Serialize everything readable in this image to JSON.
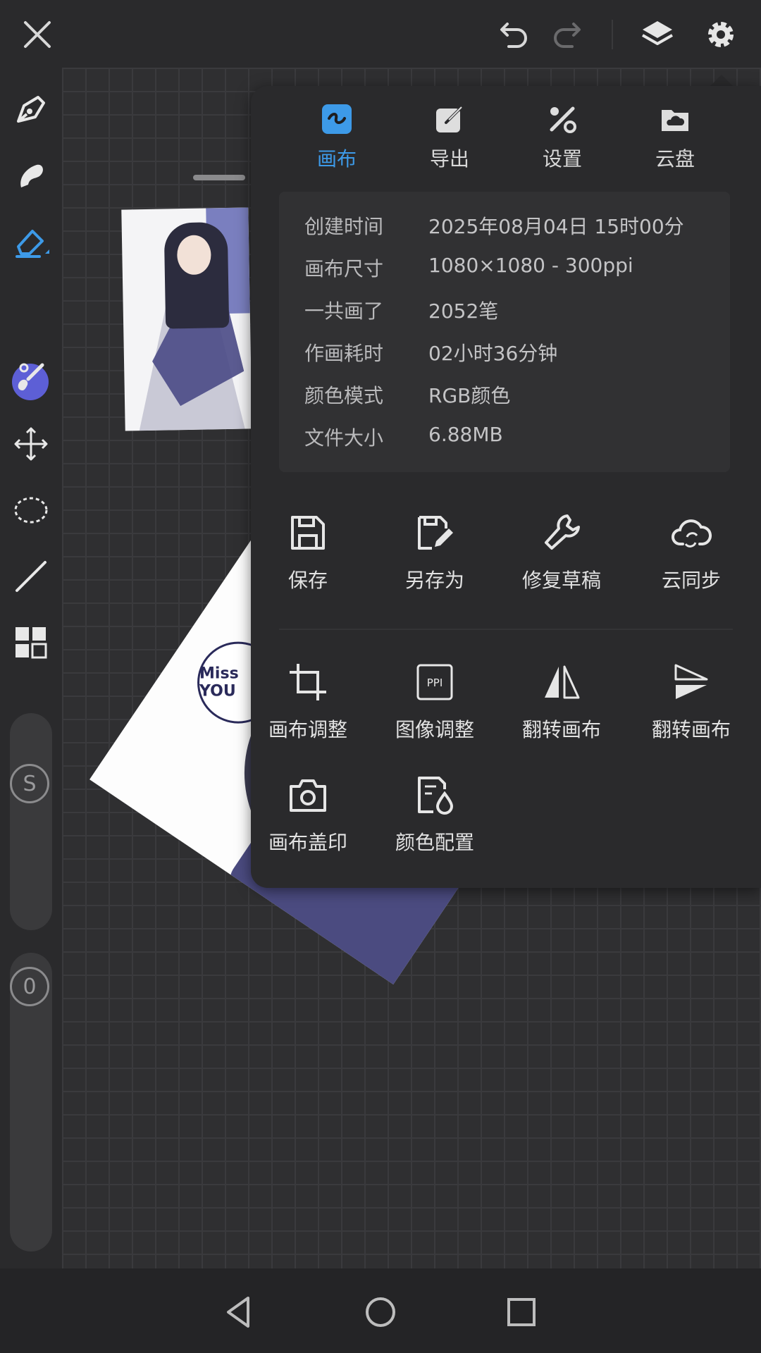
{
  "topbar": {
    "close_icon": "close-icon",
    "undo_icon": "undo-icon",
    "redo_icon": "redo-icon",
    "layers_icon": "layers-icon",
    "settings_icon": "gear-icon"
  },
  "toolbar": {
    "tools": [
      "pen",
      "smudge",
      "eraser",
      "color",
      "brush-settings",
      "move",
      "lasso",
      "line",
      "grid"
    ],
    "active_tool": "eraser",
    "color": "#5d5fd6",
    "size_slider_label": "S",
    "opacity_slider_label": "0"
  },
  "artwork": {
    "speech_text": "Miss YOU"
  },
  "panel": {
    "tabs": [
      {
        "label": "画布",
        "active": true
      },
      {
        "label": "导出",
        "active": false
      },
      {
        "label": "设置",
        "active": false
      },
      {
        "label": "云盘",
        "active": false
      }
    ],
    "info": [
      {
        "key": "创建时间",
        "value": "2025年08月04日 15时00分"
      },
      {
        "key": "画布尺寸",
        "value": "1080×1080 - 300ppi"
      },
      {
        "key": "一共画了",
        "value": "2052笔"
      },
      {
        "key": "作画耗时",
        "value": "02小时36分钟"
      },
      {
        "key": "颜色模式",
        "value": "RGB颜色"
      },
      {
        "key": "文件大小",
        "value": "6.88MB"
      }
    ],
    "actions_primary": [
      {
        "label": "保存",
        "icon": "save-icon"
      },
      {
        "label": "另存为",
        "icon": "save-as-icon"
      },
      {
        "label": "修复草稿",
        "icon": "wrench-icon"
      },
      {
        "label": "云同步",
        "icon": "cloud-sync-icon"
      }
    ],
    "actions_secondary": [
      {
        "label": "画布调整",
        "icon": "crop-icon"
      },
      {
        "label": "图像调整",
        "icon": "ppi-icon",
        "icon_text": "PPI"
      },
      {
        "label": "翻转画布",
        "icon": "flip-horizontal-icon"
      },
      {
        "label": "翻转画布",
        "icon": "flip-vertical-icon"
      },
      {
        "label": "画布盖印",
        "icon": "camera-icon"
      },
      {
        "label": "颜色配置",
        "icon": "color-profile-icon"
      }
    ]
  },
  "colors": {
    "accent": "#3d9ae8",
    "panel_bg": "#2a2a2c",
    "info_bg": "#313133"
  }
}
